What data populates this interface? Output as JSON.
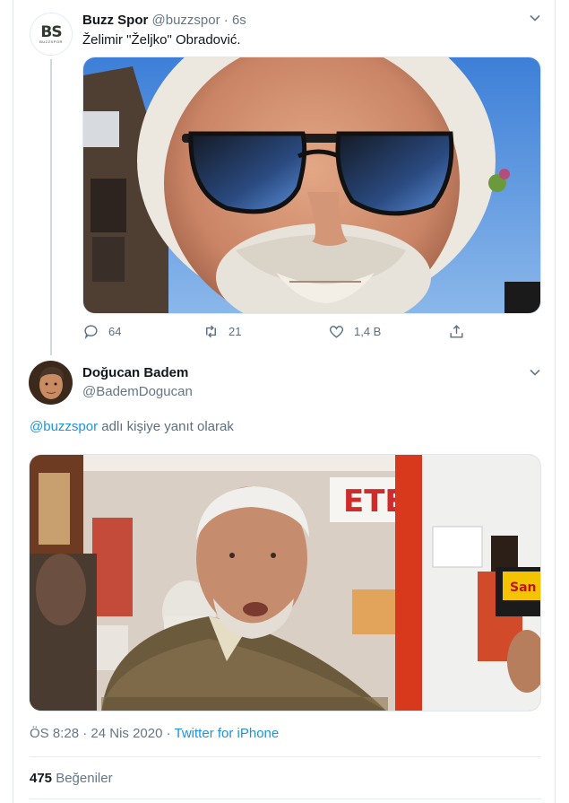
{
  "tweet1": {
    "avatar_text": "BS",
    "avatar_subtext": "BUZZSPOR",
    "name": "Buzz Spor",
    "handle": "@buzzspor",
    "separator": "·",
    "time": "6s",
    "text": "Želimir \"Željko\" Obradović.",
    "replies": "64",
    "retweets": "21",
    "likes": "1,4 B"
  },
  "tweet2": {
    "name": "Doğucan Badem",
    "handle": "@BademDogucan",
    "reply_link": "@buzzspor",
    "reply_suffix": " adlı kişiye yanıt olarak",
    "time": "ÖS 8:28",
    "separator": " · ",
    "date": "24 Nis 2020",
    "separator2": " · ",
    "source": "Twitter for iPhone",
    "like_count": "475",
    "like_label": " Beğeniler",
    "shop_sign": "ETE",
    "mic_text": "San"
  },
  "colors": {
    "link": "#1b95e0",
    "muted": "#657786",
    "brand_green": "#7bb33a"
  },
  "icons": [
    "chevron-down-icon",
    "reply-icon",
    "retweet-icon",
    "heart-icon",
    "share-icon"
  ]
}
